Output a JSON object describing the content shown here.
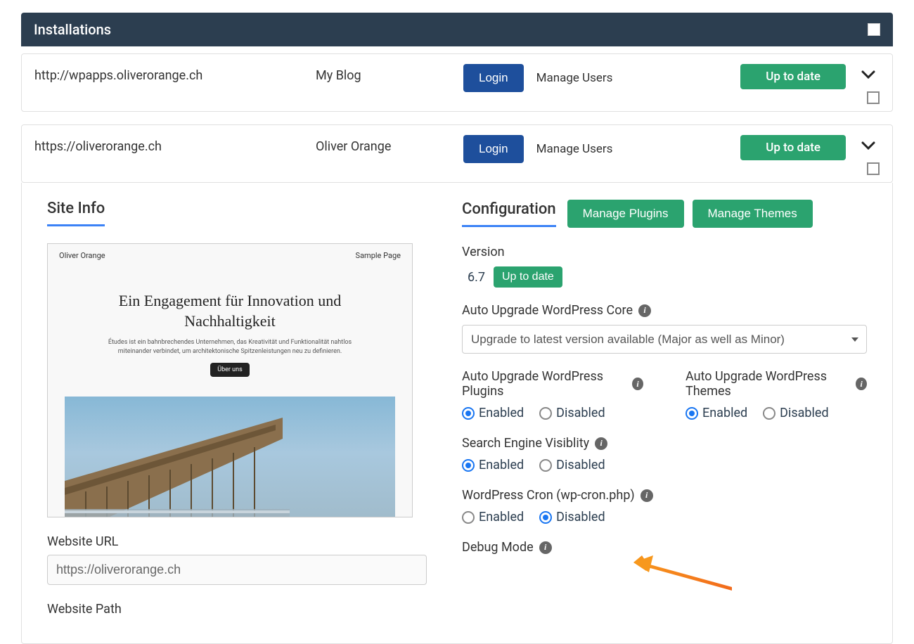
{
  "header": {
    "title": "Installations"
  },
  "rows": [
    {
      "url": "http://wpapps.oliverorange.ch",
      "name": "My Blog",
      "login": "Login",
      "manage": "Manage Users",
      "status": "Up to date"
    },
    {
      "url": "https://oliverorange.ch",
      "name": "Oliver Orange",
      "login": "Login",
      "manage": "Manage Users",
      "status": "Up to date"
    }
  ],
  "siteinfo": {
    "tab": "Site Info",
    "screenshot": {
      "brand": "Oliver Orange",
      "nav": "Sample Page",
      "headline": "Ein Engagement für Innovation und Nachhaltigkeit",
      "para": "Études ist ein bahnbrechendes Unternehmen, das Kreativität und Funktionalität nahtlos miteinander verbindet, um architektonische Spitzenleistungen neu zu definieren.",
      "cta": "Über uns"
    },
    "url_label": "Website URL",
    "url_value": "https://oliverorange.ch",
    "path_label": "Website Path"
  },
  "config": {
    "tab": "Configuration",
    "manage_plugins": "Manage Plugins",
    "manage_themes": "Manage Themes",
    "version_label": "Version",
    "version": "6.7",
    "version_status": "Up to date",
    "auto_core_label": "Auto Upgrade WordPress Core",
    "auto_core_select": "Upgrade to latest version available (Major as well as Minor)",
    "auto_plugins_label": "Auto Upgrade WordPress Plugins",
    "auto_themes_label": "Auto Upgrade WordPress Themes",
    "search_label": "Search Engine Visiblity",
    "cron_label": "WordPress Cron (wp-cron.php)",
    "debug_label": "Debug Mode",
    "opt_enabled": "Enabled",
    "opt_disabled": "Disabled"
  }
}
